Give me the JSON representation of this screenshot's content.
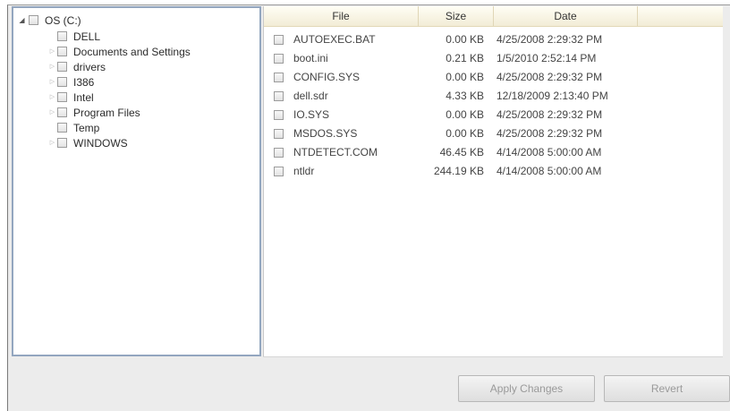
{
  "tree": {
    "root": {
      "label": "OS (C:)",
      "expander": "◢"
    },
    "items": [
      {
        "label": "DELL",
        "expander": ""
      },
      {
        "label": "Documents and Settings",
        "expander": "▷"
      },
      {
        "label": "drivers",
        "expander": "▷"
      },
      {
        "label": "I386",
        "expander": "▷"
      },
      {
        "label": "Intel",
        "expander": "▷"
      },
      {
        "label": "Program Files",
        "expander": "▷"
      },
      {
        "label": "Temp",
        "expander": ""
      },
      {
        "label": "WINDOWS",
        "expander": "▷"
      }
    ]
  },
  "files": {
    "headers": {
      "file": "File",
      "size": "Size",
      "date": "Date"
    },
    "rows": [
      {
        "name": "AUTOEXEC.BAT",
        "size": "0.00 KB",
        "date": "4/25/2008 2:29:32 PM"
      },
      {
        "name": "boot.ini",
        "size": "0.21 KB",
        "date": "1/5/2010 2:52:14 PM"
      },
      {
        "name": "CONFIG.SYS",
        "size": "0.00 KB",
        "date": "4/25/2008 2:29:32 PM"
      },
      {
        "name": "dell.sdr",
        "size": "4.33 KB",
        "date": "12/18/2009 2:13:40 PM"
      },
      {
        "name": "IO.SYS",
        "size": "0.00 KB",
        "date": "4/25/2008 2:29:32 PM"
      },
      {
        "name": "MSDOS.SYS",
        "size": "0.00 KB",
        "date": "4/25/2008 2:29:32 PM"
      },
      {
        "name": "NTDETECT.COM",
        "size": "46.45 KB",
        "date": "4/14/2008 5:00:00 AM"
      },
      {
        "name": "ntldr",
        "size": "244.19 KB",
        "date": "4/14/2008 5:00:00 AM"
      }
    ]
  },
  "buttons": {
    "apply": "Apply Changes",
    "revert": "Revert"
  }
}
